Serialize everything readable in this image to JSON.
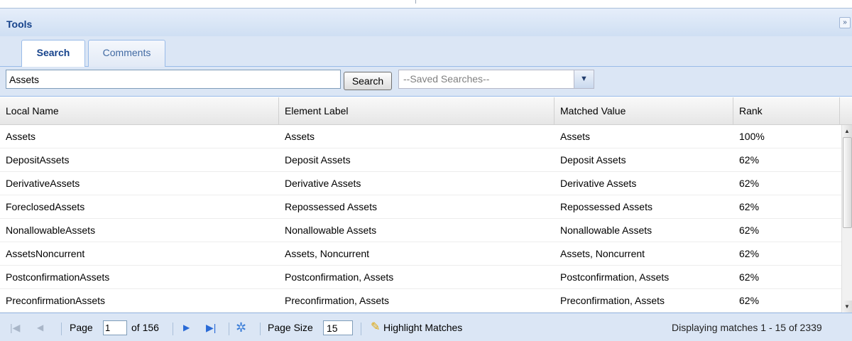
{
  "panel": {
    "title": "Tools",
    "collapse_glyph": "»"
  },
  "tabs": [
    {
      "label": "Search",
      "active": true
    },
    {
      "label": "Comments",
      "active": false
    }
  ],
  "search": {
    "value": "Assets",
    "button_label": "Search",
    "saved_searches_text": "--Saved Searches--"
  },
  "grid": {
    "columns": [
      "Local Name",
      "Element Label",
      "Matched Value",
      "Rank"
    ],
    "rows": [
      [
        "Assets",
        "Assets",
        "Assets",
        "100%"
      ],
      [
        "DepositAssets",
        "Deposit Assets",
        "Deposit Assets",
        "62%"
      ],
      [
        "DerivativeAssets",
        "Derivative Assets",
        "Derivative Assets",
        "62%"
      ],
      [
        "ForeclosedAssets",
        "Repossessed Assets",
        "Repossessed Assets",
        "62%"
      ],
      [
        "NonallowableAssets",
        "Nonallowable Assets",
        "Nonallowable Assets",
        "62%"
      ],
      [
        "AssetsNoncurrent",
        "Assets, Noncurrent",
        "Assets, Noncurrent",
        "62%"
      ],
      [
        "PostconfirmationAssets",
        "Postconfirmation, Assets",
        "Postconfirmation, Assets",
        "62%"
      ],
      [
        "PreconfirmationAssets",
        "Preconfirmation, Assets",
        "Preconfirmation, Assets",
        "62%"
      ]
    ]
  },
  "paging": {
    "page_label": "Page",
    "page_value": "1",
    "of_label": "of 156",
    "page_size_label": "Page Size",
    "page_size_value": "15",
    "highlight_label": "Highlight Matches",
    "display_text": "Displaying matches 1 - 15 of 2339"
  },
  "icons": {
    "first": "first-page-icon",
    "prev": "prev-page-icon",
    "next": "next-page-icon",
    "last": "last-page-icon",
    "refresh": "refresh-icon",
    "highlight": "highlighter-icon"
  },
  "colors": {
    "header_text": "#15428b",
    "toolbar_bg": "#dbe6f5",
    "border": "#99bbe8",
    "nav_blue": "#2a6ad6"
  }
}
